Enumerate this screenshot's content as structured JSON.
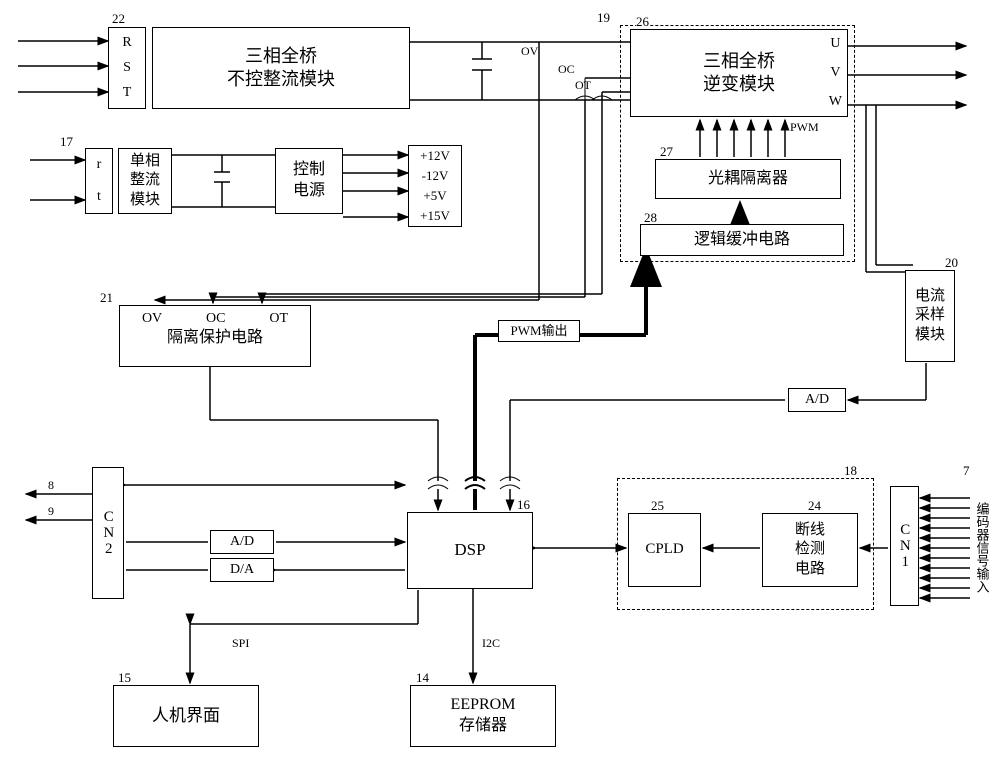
{
  "blocks": {
    "b22": {
      "num": "22",
      "pins": "R S T",
      "title": "三相全桥\n不控整流模块"
    },
    "b17": {
      "num": "17",
      "pins": "r t",
      "title": "单相\n整流\n模块"
    },
    "ctrl_power": {
      "title": "控制\n电源",
      "outputs": [
        "+12V",
        "-12V",
        "+5V",
        "+15V"
      ]
    },
    "b19": {
      "num": "19"
    },
    "b26": {
      "num": "26",
      "title": "三相全桥\n逆变模块",
      "pins": "U V W"
    },
    "b27": {
      "num": "27",
      "title": "光耦隔离器"
    },
    "b28": {
      "num": "28",
      "title": "逻辑缓冲电路"
    },
    "b20": {
      "num": "20",
      "title": "电流\n采样\n模块"
    },
    "b21": {
      "num": "21",
      "title": "隔离保护电路",
      "pins": "OV   OC   OT"
    },
    "pwm_out": {
      "title": "PWM输出"
    },
    "pwm": "PWM",
    "ad": {
      "title": "A/D"
    },
    "b16": {
      "num": "16",
      "title": "DSP"
    },
    "b25": {
      "num": "25",
      "title": "CPLD"
    },
    "b24": {
      "num": "24",
      "title": "断线\n检测\n电路"
    },
    "b18": {
      "num": "18"
    },
    "cn1": {
      "title": "CN1"
    },
    "cn2": {
      "title": "CN2"
    },
    "encoder_input": {
      "num": "7",
      "title": "编码器信号输入"
    },
    "b15": {
      "num": "15",
      "title": "人机界面"
    },
    "b14": {
      "num": "14",
      "title": "EEPROM\n存储器"
    },
    "ad2": {
      "title": "A/D"
    },
    "da": {
      "title": "D/A"
    },
    "line8": "8",
    "line9": "9",
    "spi": "SPI",
    "i2c": "I2C",
    "ov": "OV",
    "oc": "OC",
    "ot": "OT"
  }
}
